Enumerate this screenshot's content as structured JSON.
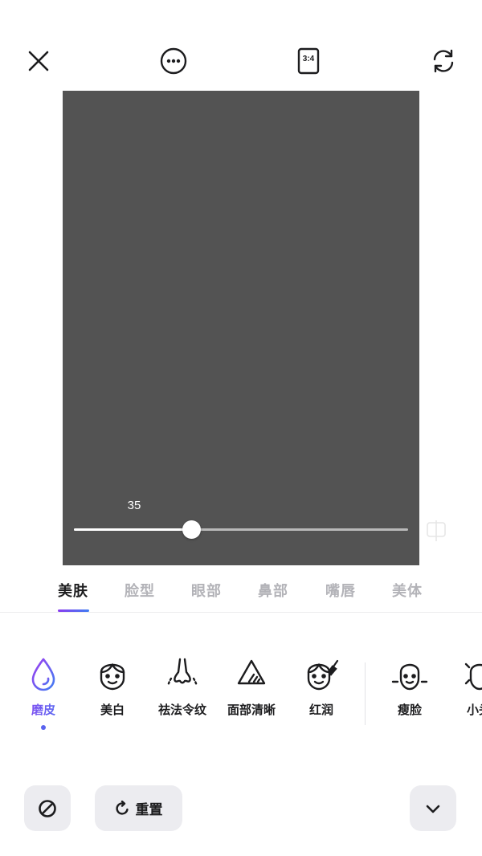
{
  "top_bar": {
    "icons": [
      "close-icon",
      "more-icon",
      "aspect-ratio-icon",
      "switch-camera-icon"
    ],
    "aspect_ratio_label": "3:4"
  },
  "canvas": {
    "background": "#535353"
  },
  "slider": {
    "value_label": "35",
    "value": 35,
    "min": 0,
    "max": 100
  },
  "tabs": [
    {
      "label": "美肤",
      "active": true
    },
    {
      "label": "脸型",
      "active": false
    },
    {
      "label": "眼部",
      "active": false
    },
    {
      "label": "鼻部",
      "active": false
    },
    {
      "label": "嘴唇",
      "active": false
    },
    {
      "label": "美体",
      "active": false
    }
  ],
  "tools": [
    {
      "label": "磨皮",
      "icon": "droplet-icon",
      "active": true
    },
    {
      "label": "美白",
      "icon": "face-whiten-icon",
      "active": false
    },
    {
      "label": "祛法令纹",
      "icon": "nose-lines-icon",
      "active": false
    },
    {
      "label": "面部清晰",
      "icon": "sharpen-triangle-icon",
      "active": false
    },
    {
      "label": "红润",
      "icon": "face-blush-icon",
      "active": false
    },
    {
      "label": "瘦脸",
      "icon": "slim-face-icon",
      "active": false
    },
    {
      "label": "小头",
      "icon": "small-head-icon",
      "active": false
    }
  ],
  "bottom": {
    "none_icon": "disable-icon",
    "reset_label": "重置",
    "collapse_icon": "chevron-down-icon"
  },
  "colors": {
    "accent_start": "#8a3cf0",
    "accent_end": "#3f7df2"
  }
}
